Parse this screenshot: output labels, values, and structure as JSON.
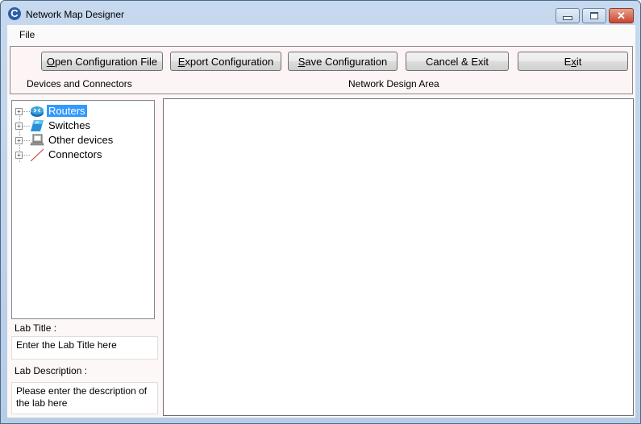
{
  "window": {
    "title": "Network Map Designer",
    "app_icon": "C",
    "controls": {
      "minimize": "minimize",
      "maximize": "maximize",
      "close": "✕"
    }
  },
  "menu": {
    "file": "File"
  },
  "toolbar": {
    "open": {
      "mnemonic": "O",
      "rest": "pen Configuration File"
    },
    "export": {
      "mnemonic": "E",
      "rest": "xport Configuration"
    },
    "save": {
      "mnemonic": "S",
      "rest": "ave Configuration"
    },
    "cancel": {
      "label": "Cancel & Exit"
    },
    "exit": {
      "pre": "E",
      "mnemonic": "x",
      "rest": "it"
    }
  },
  "sections": {
    "devices": "Devices and Connectors",
    "design": "Network Design Area"
  },
  "tree": {
    "items": [
      {
        "label": "Routers",
        "icon": "router-icon",
        "selected": true
      },
      {
        "label": "Switches",
        "icon": "switch-icon",
        "selected": false
      },
      {
        "label": "Other devices",
        "icon": "computer-icon",
        "selected": false
      },
      {
        "label": "Connectors",
        "icon": "connector-icon",
        "selected": false
      }
    ],
    "expander": "+"
  },
  "lab": {
    "title_label": "Lab Title :",
    "title_value": "Enter the Lab Title here",
    "description_label": "Lab Description :",
    "description_value": "Please enter the description of the lab here"
  },
  "colors": {
    "selection": "#3399ff",
    "panel_bg": "#fdf5f5",
    "close_button": "#c9452e"
  }
}
